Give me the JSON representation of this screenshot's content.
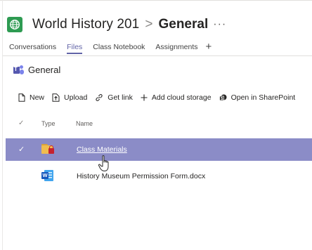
{
  "header": {
    "team_name": "World History 201",
    "separator": ">",
    "channel_name": "General",
    "more": "···"
  },
  "tabs": [
    {
      "label": "Conversations",
      "active": false
    },
    {
      "label": "Files",
      "active": true
    },
    {
      "label": "Class Notebook",
      "active": false
    },
    {
      "label": "Assignments",
      "active": false
    }
  ],
  "tab_add": "+",
  "section": {
    "title": "General"
  },
  "toolbar": {
    "new_label": "New",
    "upload_label": "Upload",
    "get_link_label": "Get link",
    "add_cloud_label": "Add cloud storage",
    "open_sharepoint_label": "Open in SharePoint"
  },
  "columns": {
    "check": "✓",
    "type": "Type",
    "name": "Name"
  },
  "files": [
    {
      "name": "Class Materials",
      "type_icon": "locked-folder-icon",
      "selected": true
    },
    {
      "name": "History Museum Permission Form.docx",
      "type_icon": "word-document-icon",
      "selected": false
    }
  ],
  "colors": {
    "accent": "#6264a7",
    "selected_row": "#8b8cc7",
    "team_icon": "#2e9b52",
    "word_blue": "#185abd",
    "folder_yellow": "#f0bd4f",
    "lock_red": "#c5222f"
  }
}
